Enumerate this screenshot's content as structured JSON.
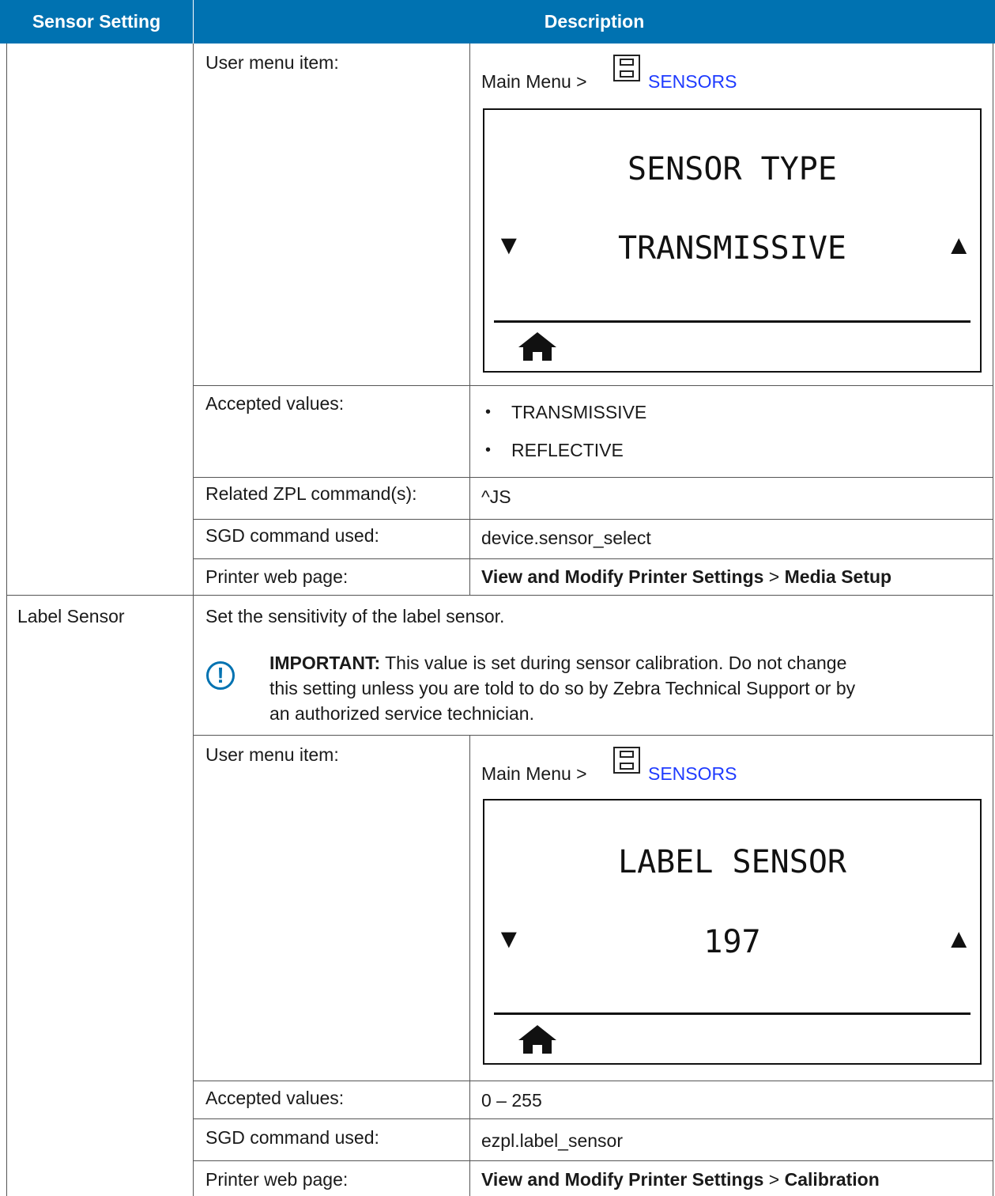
{
  "header": {
    "col1": "Sensor Setting",
    "col2": "Description"
  },
  "rows": [
    {
      "setting": "",
      "user_menu_label": "User menu item:",
      "menu_path_prefix": "Main Menu > ",
      "menu_link": "SENSORS",
      "lcd": {
        "title": "SENSOR TYPE",
        "value": "TRANSMISSIVE"
      },
      "accepted_label": "Accepted values:",
      "accepted_values": [
        "TRANSMISSIVE",
        "REFLECTIVE"
      ],
      "zpl_label": "Related ZPL command(s):",
      "zpl_value": "^JS",
      "sgd_label": "SGD command used:",
      "sgd_value": "device.sensor_select",
      "web_label": "Printer web page:",
      "web_part1": "View and Modify Printer Settings",
      "web_sep": " > ",
      "web_part2": "Media Setup"
    },
    {
      "setting": "Label Sensor",
      "intro": "Set the sensitivity of the label sensor.",
      "important_label": "IMPORTANT:",
      "important_lines": [
        " This value is set during sensor calibration. Do not change",
        "this setting unless you are told to do so by Zebra Technical Support or by",
        "an authorized service technician."
      ],
      "user_menu_label": "User menu item:",
      "menu_path_prefix": "Main Menu > ",
      "menu_link": "SENSORS",
      "lcd": {
        "title": "LABEL SENSOR",
        "value": "197"
      },
      "accepted_label": "Accepted values:",
      "accepted_value": "0 – 255",
      "sgd_label": "SGD command used:",
      "sgd_value": "ezpl.label_sensor",
      "web_label": "Printer web page:",
      "web_part1": "View and Modify Printer Settings",
      "web_sep": " > ",
      "web_part2": "Calibration"
    }
  ],
  "icons": {
    "menu": "sensors-menu-icon",
    "home": "home-icon",
    "down": "down-arrow-icon",
    "up": "up-arrow-icon",
    "important": "important-icon"
  },
  "colors": {
    "header_bg": "#0072b1",
    "link": "#1f3bff",
    "important": "#0072b1"
  }
}
